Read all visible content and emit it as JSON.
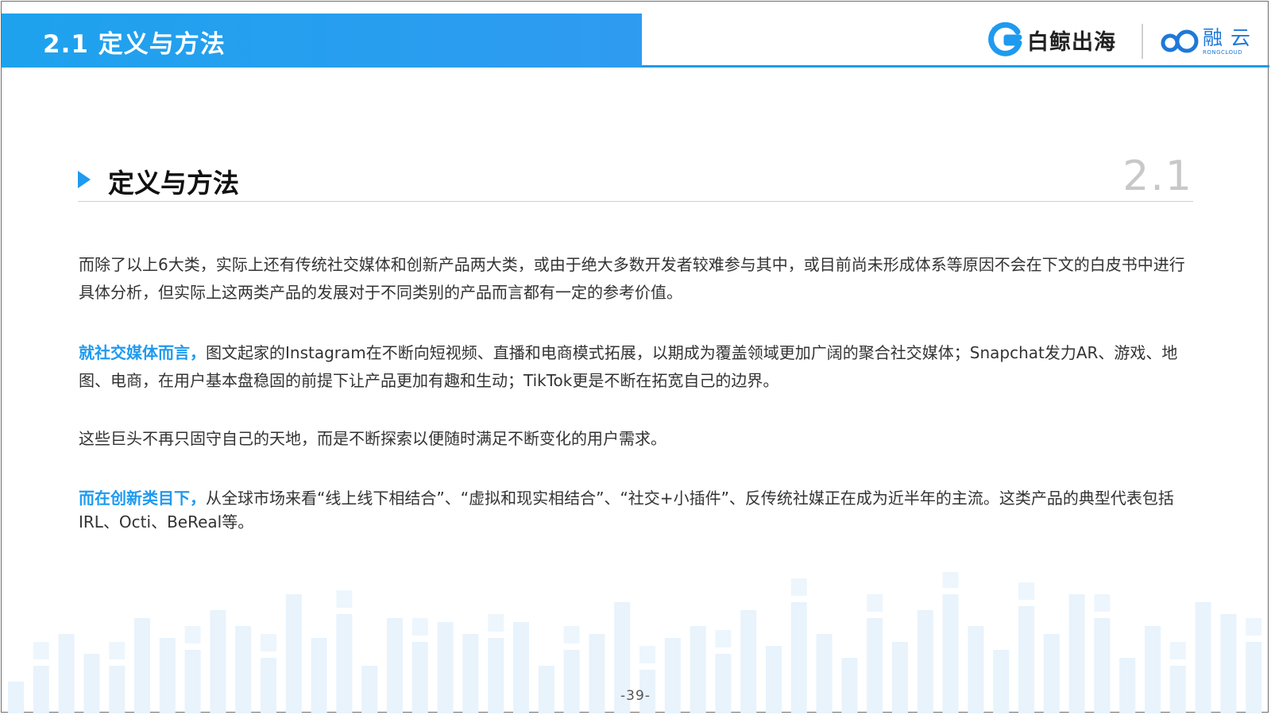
{
  "header": {
    "banner_title": "2.1 定义与方法",
    "logos": {
      "baijing_text": "白鲸出海",
      "rong_cn": "融云",
      "rong_en": "RONGCLOUD"
    },
    "accent_color": "#1e9af0"
  },
  "section": {
    "title": "定义与方法",
    "number": "2.1"
  },
  "paragraphs": {
    "p1": "而除了以上6大类，实际上还有传统社交媒体和创新产品两大类，或由于绝大多数开发者较难参与其中，或目前尚未形成体系等原因不会在下文的白皮书中进行具体分析，但实际上这两类产品的发展对于不同类别的产品而言都有一定的参考价值。",
    "p2_lead": "就社交媒体而言，",
    "p2_body": "图文起家的Instagram在不断向短视频、直播和电商模式拓展，以期成为覆盖领域更加广阔的聚合社交媒体；Snapchat发力AR、游戏、地图、电商，在用户基本盘稳固的前提下让产品更加有趣和生动；TikTok更是不断在拓宽自己的边界。",
    "p3": "这些巨头不再只固守自己的天地，而是不断探索以便随时满足不断变化的用户需求。",
    "p4_lead": "而在创新类目下，",
    "p4_body": "从全球市场来看“线上线下相结合”、“虚拟和现实相结合”、“社交+小插件”、反传统社媒正在成为近半年的主流。这类产品的典型代表包括IRL、Octi、BeReal等。"
  },
  "footer": {
    "page_number": "-39-"
  }
}
